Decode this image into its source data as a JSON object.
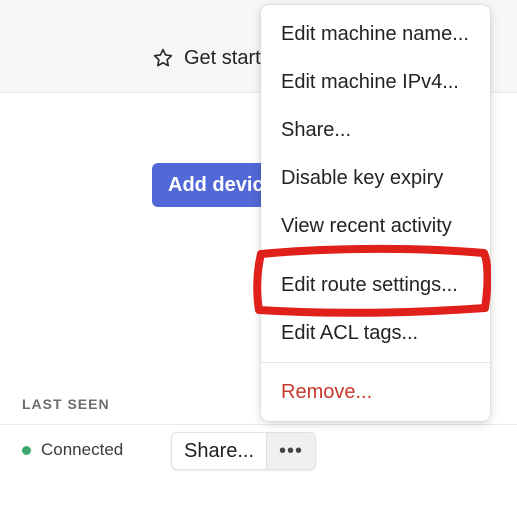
{
  "header": {
    "get_started_label": "Get started"
  },
  "main": {
    "add_device_label": "Add device"
  },
  "table": {
    "column_header": "LAST SEEN",
    "row": {
      "status": "Connected",
      "status_color": "#3ea871",
      "share_label": "Share...",
      "more_label": "•••"
    }
  },
  "menu": {
    "items": [
      {
        "label": "Edit machine name..."
      },
      {
        "label": "Edit machine IPv4..."
      },
      {
        "label": "Share..."
      },
      {
        "label": "Disable key expiry"
      },
      {
        "label": "View recent activity"
      },
      {
        "label": "Edit route settings..."
      },
      {
        "label": "Edit ACL tags..."
      },
      {
        "label": "Remove..."
      }
    ],
    "highlighted_item": "Edit route settings...",
    "highlight_color": "#e0201b",
    "danger_color": "#c63a2d"
  },
  "icons": {
    "get_started": "star-icon",
    "more": "ellipsis-icon"
  }
}
